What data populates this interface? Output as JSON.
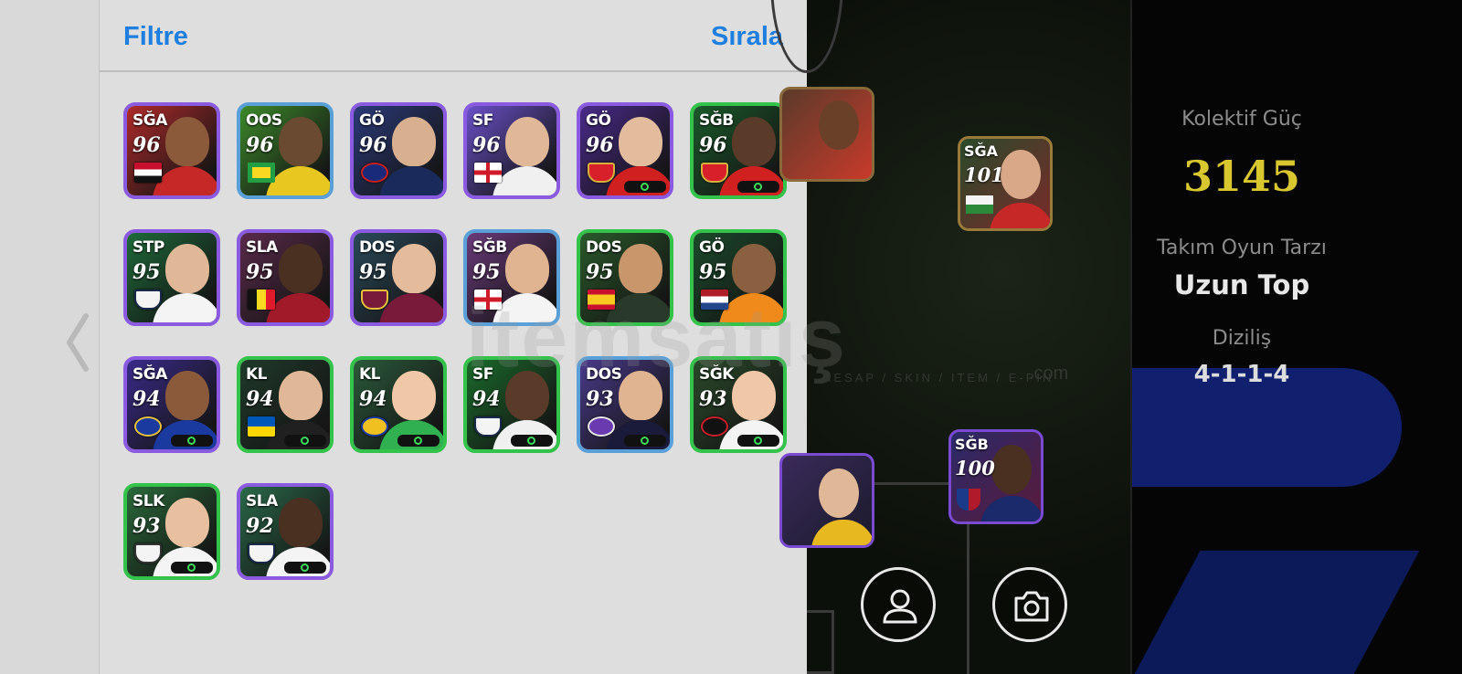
{
  "panel": {
    "filter_label": "Filtre",
    "sort_label": "Sırala"
  },
  "players": [
    {
      "pos": "SĞA",
      "rating": "96",
      "frame": "p",
      "bg": "#b02a2a",
      "skin": "#8a5a3a",
      "kit": "#c62828",
      "emblem": "egypt-flag"
    },
    {
      "pos": "OOS",
      "rating": "96",
      "frame": "b",
      "bg": "#3d8a2a",
      "skin": "#6a4a30",
      "kit": "#e8c820",
      "emblem": "brazil-flag"
    },
    {
      "pos": "GÖ",
      "rating": "96",
      "frame": "p",
      "bg": "#2b3a7a",
      "skin": "#d8b090",
      "kit": "#1a2a5a",
      "emblem": "psg-crest"
    },
    {
      "pos": "SF",
      "rating": "96",
      "frame": "p",
      "bg": "#6a50c8",
      "skin": "#e0b898",
      "kit": "#f0f0f0",
      "emblem": "england-flag"
    },
    {
      "pos": "GÖ",
      "rating": "96",
      "frame": "p",
      "bg": "#4a2a8a",
      "skin": "#e2bc9c",
      "kit": "#d02020",
      "emblem": "arsenal-crest"
    },
    {
      "pos": "SĞB",
      "rating": "96",
      "frame": "g",
      "bg": "#1a5a2a",
      "skin": "#5a3a28",
      "kit": "#d02020",
      "emblem": "arsenal-crest"
    },
    {
      "pos": "STP",
      "rating": "95",
      "frame": "p",
      "bg": "#1f6a3a",
      "skin": "#e0b898",
      "kit": "#f4f4f4",
      "emblem": "tottenham-crest"
    },
    {
      "pos": "SLA",
      "rating": "95",
      "frame": "p",
      "bg": "#5a2a4a",
      "skin": "#4a3020",
      "kit": "#a01a2a",
      "emblem": "belgium-flag"
    },
    {
      "pos": "DOS",
      "rating": "95",
      "frame": "p",
      "bg": "#2a4a5a",
      "skin": "#e4bc9c",
      "kit": "#7a1a3a",
      "emblem": "westham-crest"
    },
    {
      "pos": "SĞB",
      "rating": "95",
      "frame": "b",
      "bg": "#6a3a7a",
      "skin": "#e0b490",
      "kit": "#f4f4f4",
      "emblem": "england-flag"
    },
    {
      "pos": "DOS",
      "rating": "95",
      "frame": "g",
      "bg": "#2a5a2a",
      "skin": "#c8966a",
      "kit": "#2a3a2a",
      "emblem": "spain-flag"
    },
    {
      "pos": "GÖ",
      "rating": "95",
      "frame": "g",
      "bg": "#1a4a2a",
      "skin": "#8a6040",
      "kit": "#f08a1a",
      "emblem": "netherlands-flag"
    },
    {
      "pos": "SĞA",
      "rating": "94",
      "frame": "p",
      "bg": "#3a2a8a",
      "skin": "#8a5a3a",
      "kit": "#1a3aa0",
      "emblem": "crest-blue"
    },
    {
      "pos": "KL",
      "rating": "94",
      "frame": "g",
      "bg": "#1f3a2a",
      "skin": "#e0b898",
      "kit": "#202020",
      "emblem": "ukraine-flag"
    },
    {
      "pos": "KL",
      "rating": "94",
      "frame": "g",
      "bg": "#2a5a3a",
      "skin": "#f0c8a8",
      "kit": "#30b050",
      "emblem": "crest-yellow"
    },
    {
      "pos": "SF",
      "rating": "94",
      "frame": "g",
      "bg": "#1a6a2a",
      "skin": "#5a3a28",
      "kit": "#f0f0f0",
      "emblem": "tottenham-crest"
    },
    {
      "pos": "DOS",
      "rating": "93",
      "frame": "b",
      "bg": "#4a3a8a",
      "skin": "#e0b490",
      "kit": "#1a1a3a",
      "emblem": "crest-purple"
    },
    {
      "pos": "SĞK",
      "rating": "93",
      "frame": "g",
      "bg": "#2a4a2a",
      "skin": "#f0c8a8",
      "kit": "#f4f4f4",
      "emblem": "crest-black"
    },
    {
      "pos": "SLK",
      "rating": "93",
      "frame": "g",
      "bg": "#2a6a3a",
      "skin": "#e8c0a0",
      "kit": "#f4f4f4",
      "emblem": "crest-white"
    },
    {
      "pos": "SLA",
      "rating": "92",
      "frame": "p",
      "bg": "#2a6a4a",
      "skin": "#4a3020",
      "kit": "#f4f4f4",
      "emblem": "tottenham-crest"
    }
  ],
  "field_cards": [
    {
      "pos": "SĞA",
      "rating": "101"
    },
    {
      "pos": "SĞB",
      "rating": "100"
    }
  ],
  "info": {
    "collective_label": "Kolektif Güç",
    "collective_value": "3145",
    "style_label": "Takım Oyun Tarzı",
    "style_value": "Uzun Top",
    "formation_label": "Diziliş",
    "formation_value": "4-1-1-4"
  },
  "watermark": {
    "brand": "itemsatış",
    "tagline": "HESAP / SKIN / ITEM / E-PIN",
    "domain": ".com"
  },
  "colors": {
    "accent_blue": "#1f7fe0",
    "power_yellow": "#d9c730",
    "frame_green": "#33c24a",
    "frame_purple": "#8a5ae0"
  },
  "icons": [
    "back-chevron-icon",
    "profile-icon",
    "camera-icon"
  ]
}
